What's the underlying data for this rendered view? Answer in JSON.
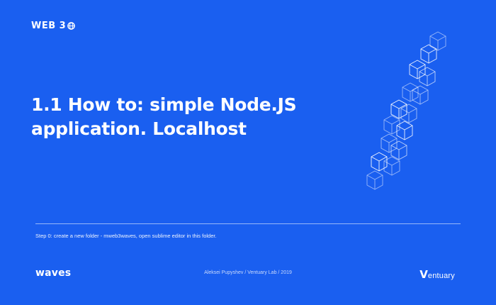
{
  "header": {
    "logo_text": "WEB 3",
    "logo_icon": "globe-icon"
  },
  "title": {
    "line1": "1.1 How to: simple Node.JS",
    "line2": "application. Localhost"
  },
  "step_text": "Step 0: create a new folder - mweb3waves, open sublime editor in this folder.",
  "footer": {
    "left_logo": "waves",
    "credit": "Aleksei Pupyshev / Ventuary Lab / 2019",
    "right_logo_mark": "V",
    "right_logo_rest": "entuary"
  },
  "colors": {
    "background": "#1a5ff0",
    "foreground": "#ffffff"
  },
  "decoration": {
    "icon": "cube-chain-icon"
  }
}
